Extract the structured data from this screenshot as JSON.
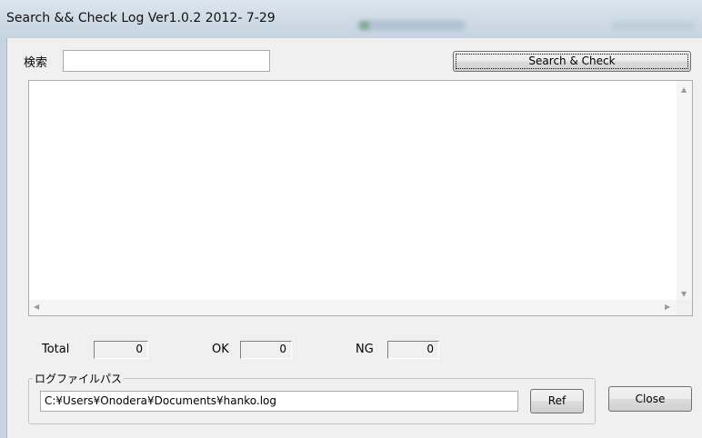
{
  "window": {
    "title": "Search && Check Log Ver1.0.2 2012- 7-29"
  },
  "search": {
    "label": "検索",
    "value": "",
    "button_label": "Search & Check"
  },
  "log": {
    "content": ""
  },
  "counts": {
    "total_label": "Total",
    "total_value": "0",
    "ok_label": "OK",
    "ok_value": "0",
    "ng_label": "NG",
    "ng_value": "0"
  },
  "logfile": {
    "group_label": "ログファイルパス",
    "path": "C:¥Users¥Onodera¥Documents¥hanko.log",
    "ref_label": "Ref"
  },
  "actions": {
    "close_label": "Close"
  },
  "icons": {
    "scroll_up": "scroll-up-arrow-icon",
    "scroll_down": "scroll-down-arrow-icon",
    "scroll_left": "scroll-left-arrow-icon",
    "scroll_right": "scroll-right-arrow-icon"
  }
}
